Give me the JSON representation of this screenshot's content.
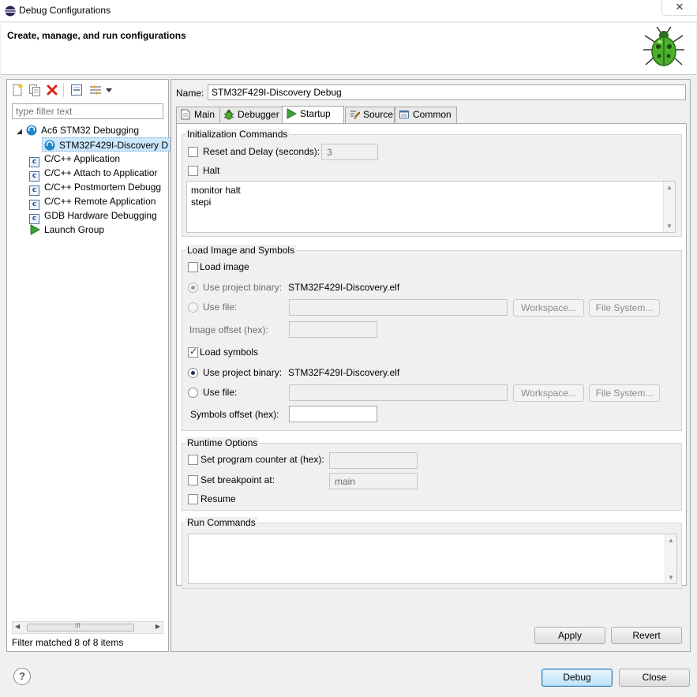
{
  "window": {
    "title": "Debug Configurations",
    "close_glyph": "✕"
  },
  "header": {
    "title": "Create, manage, and run configurations"
  },
  "left": {
    "toolbar_icons": [
      "new-config-icon",
      "duplicate-icon",
      "delete-icon",
      "collapse-all-icon",
      "filter-icon",
      "dropdown-icon"
    ],
    "filter_placeholder": "type filter text",
    "tree": [
      {
        "label": "Ac6 STM32 Debugging",
        "level": 0,
        "icon": "ac6-icon",
        "expanded": true
      },
      {
        "label": "STM32F429I-Discovery D",
        "level": 1,
        "icon": "ac6-config-icon",
        "selected": true
      },
      {
        "label": "C/C++ Application",
        "level": 0,
        "icon": "c-icon"
      },
      {
        "label": "C/C++ Attach to Applicatior",
        "level": 0,
        "icon": "c-icon"
      },
      {
        "label": "C/C++ Postmortem Debugg",
        "level": 0,
        "icon": "c-icon"
      },
      {
        "label": "C/C++ Remote Application",
        "level": 0,
        "icon": "c-icon"
      },
      {
        "label": "GDB Hardware Debugging",
        "level": 0,
        "icon": "c-icon"
      },
      {
        "label": "Launch Group",
        "level": 0,
        "icon": "launch-group-icon"
      }
    ],
    "scroll_thumb_label": "III",
    "status": "Filter matched 8 of 8 items"
  },
  "right": {
    "name_label": "Name:",
    "name_value": "STM32F429I-Discovery Debug",
    "tabs": [
      {
        "label": "Main",
        "icon": "main-tab-icon"
      },
      {
        "label": "Debugger",
        "icon": "debugger-tab-icon"
      },
      {
        "label": "Startup",
        "icon": "startup-tab-icon",
        "active": true
      },
      {
        "label": "Source",
        "icon": "source-tab-icon"
      },
      {
        "label": "Common",
        "icon": "common-tab-icon"
      }
    ],
    "init": {
      "title": "Initialization Commands",
      "reset_label": "Reset and Delay (seconds):",
      "reset_checked": false,
      "reset_value": "3",
      "halt_label": "Halt",
      "halt_checked": false,
      "commands": [
        "monitor halt",
        "stepi"
      ]
    },
    "load": {
      "title": "Load Image and Symbols",
      "load_image_label": "Load image",
      "load_image_checked": false,
      "image_use_project_label": "Use project binary:",
      "image_project_binary": "STM32F429I-Discovery.elf",
      "image_use_file_label": "Use file:",
      "workspace_label": "Workspace...",
      "filesystem_label": "File System...",
      "image_offset_label": "Image offset (hex):",
      "load_symbols_label": "Load symbols",
      "load_symbols_checked": true,
      "symbols_use_project_label": "Use project binary:",
      "symbols_project_binary": "STM32F429I-Discovery.elf",
      "symbols_use_file_label": "Use file:",
      "symbols_offset_label": "Symbols offset (hex):"
    },
    "runtime": {
      "title": "Runtime Options",
      "pc_label": "Set program counter at (hex):",
      "bp_label": "Set breakpoint at:",
      "bp_value": "main",
      "resume_label": "Resume"
    },
    "run": {
      "title": "Run Commands"
    },
    "apply_label": "Apply",
    "revert_label": "Revert"
  },
  "footer": {
    "help_glyph": "?",
    "debug_label": "Debug",
    "close_label": "Close"
  },
  "colors": {
    "accent": "#3399ff",
    "selection": "#cce8ff",
    "bug_green": "#4caf2e"
  }
}
